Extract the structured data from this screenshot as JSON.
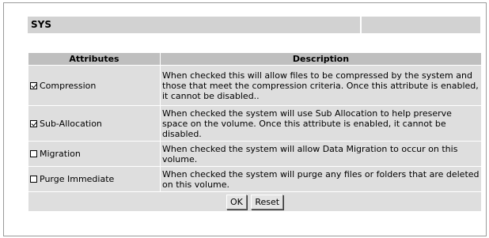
{
  "header": {
    "title": "SYS"
  },
  "table": {
    "columns": [
      "Attributes",
      "Description"
    ],
    "rows": [
      {
        "label": "Compression",
        "checked": true,
        "description": "When checked this will allow files to be compressed by the system and those that meet the compression criteria. Once this attribute is enabled, it cannot be disabled.."
      },
      {
        "label": "Sub-Allocation",
        "checked": true,
        "description": "When checked the system will use Sub Allocation to help preserve space on the volume. Once this attribute is enabled, it cannot be disabled."
      },
      {
        "label": "Migration",
        "checked": false,
        "description": "When checked the system will allow Data Migration to occur on this volume."
      },
      {
        "label": "Purge Immediate",
        "checked": false,
        "description": "When checked the system will purge any files or folders that are deleted on this volume."
      }
    ]
  },
  "buttons": {
    "ok": "OK",
    "reset": "Reset"
  }
}
